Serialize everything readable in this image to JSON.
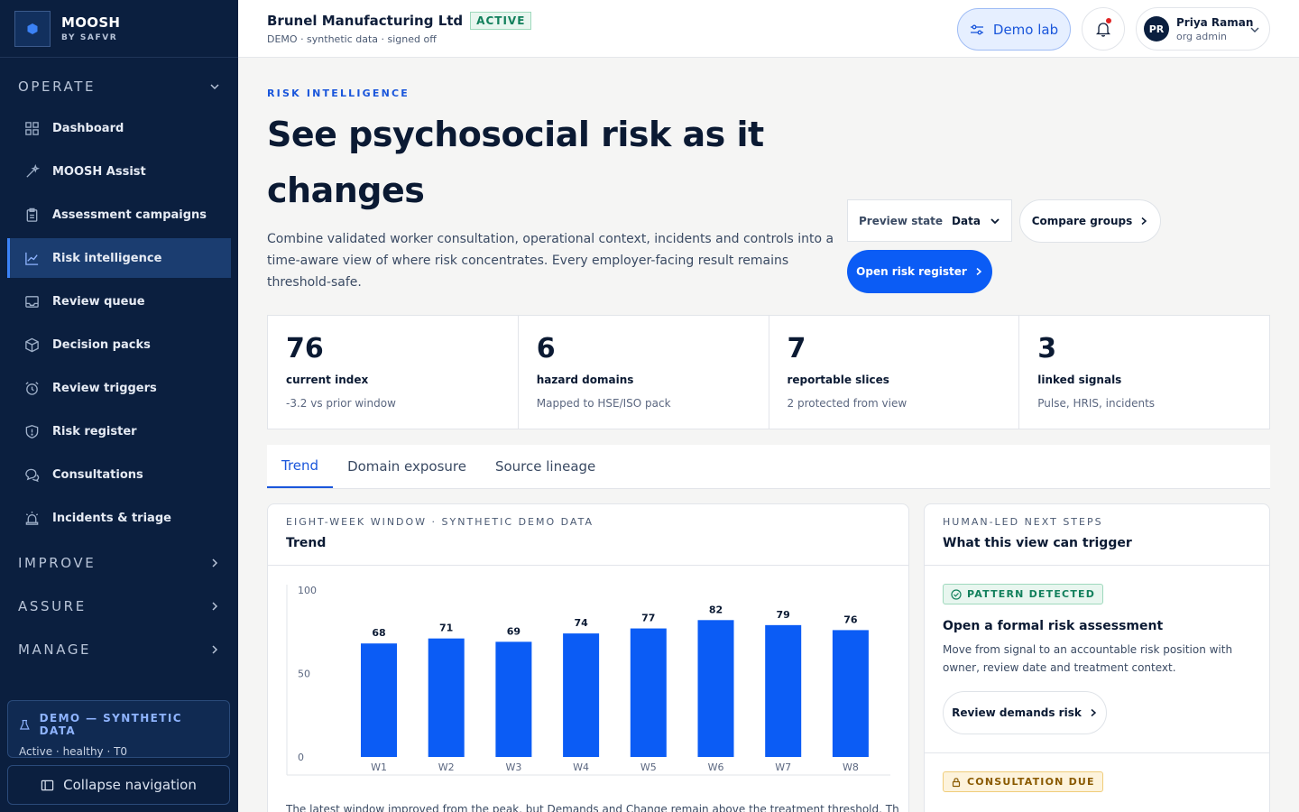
{
  "brand": {
    "name": "MOOSH",
    "sub": "BY SAFVR"
  },
  "nav": {
    "operate_label": "OPERATE",
    "items": [
      {
        "label": "Dashboard",
        "icon": "grid-icon"
      },
      {
        "label": "MOOSH Assist",
        "icon": "wand-icon"
      },
      {
        "label": "Assessment campaigns",
        "icon": "clipboard-icon"
      },
      {
        "label": "Risk intelligence",
        "icon": "chart-line-icon",
        "active": true
      },
      {
        "label": "Review queue",
        "icon": "inbox-icon"
      },
      {
        "label": "Decision packs",
        "icon": "package-icon"
      },
      {
        "label": "Review triggers",
        "icon": "alarm-icon"
      },
      {
        "label": "Risk register",
        "icon": "shield-icon"
      },
      {
        "label": "Consultations",
        "icon": "chat-icon"
      },
      {
        "label": "Incidents & triage",
        "icon": "siren-icon"
      }
    ],
    "improve_label": "IMPROVE",
    "assure_label": "ASSURE",
    "manage_label": "MANAGE",
    "demo_title": "DEMO — SYNTHETIC DATA",
    "demo_sub": "Active · healthy · T0",
    "collapse_label": "Collapse navigation"
  },
  "topbar": {
    "org_name": "Brunel Manufacturing Ltd",
    "status": "ACTIVE",
    "org_sub": "DEMO · synthetic data · signed off",
    "demo_lab": "Demo lab",
    "user_initials": "PR",
    "user_name": "Priya Raman",
    "user_role": "org admin"
  },
  "hero": {
    "eyebrow": "RISK INTELLIGENCE",
    "title": "See psychosocial risk as it changes",
    "description": "Combine validated worker consultation, operational context, incidents and controls into a time-aware view of where risk concentrates. Every employer-facing result remains threshold-safe.",
    "preview_label": "Preview state",
    "preview_value": "Data",
    "compare_label": "Compare groups",
    "open_label": "Open risk register"
  },
  "stats": [
    {
      "value": "76",
      "label": "current index",
      "note": "-3.2 vs prior window"
    },
    {
      "value": "6",
      "label": "hazard domains",
      "note": "Mapped to HSE/ISO pack"
    },
    {
      "value": "7",
      "label": "reportable slices",
      "note": "2 protected from view"
    },
    {
      "value": "3",
      "label": "linked signals",
      "note": "Pulse, HRIS, incidents"
    }
  ],
  "tabs": [
    {
      "label": "Trend",
      "active": true
    },
    {
      "label": "Domain exposure"
    },
    {
      "label": "Source lineage"
    }
  ],
  "trend_card": {
    "eyebrow": "EIGHT-WEEK WINDOW · SYNTHETIC DEMO DATA",
    "title": "Trend",
    "note": "The latest window improved from the peak, but Demands and Change remain above the treatment threshold. The"
  },
  "chart_data": {
    "type": "bar",
    "categories": [
      "W1",
      "W2",
      "W3",
      "W4",
      "W5",
      "W6",
      "W7",
      "W8"
    ],
    "values": [
      68,
      71,
      69,
      74,
      77,
      82,
      79,
      76
    ],
    "ylim": [
      0,
      100
    ],
    "yticks": [
      0,
      50,
      100
    ],
    "color": "#0b5cf5"
  },
  "steps_card": {
    "eyebrow": "HUMAN-LED NEXT STEPS",
    "title": "What this view can trigger",
    "steps": [
      {
        "badge": "PATTERN DETECTED",
        "title": "Open a formal risk assessment",
        "desc": "Move from signal to an accountable risk position with owner, review date and treatment context.",
        "action": "Review demands risk"
      },
      {
        "badge": "CONSULTATION DUE"
      }
    ]
  }
}
